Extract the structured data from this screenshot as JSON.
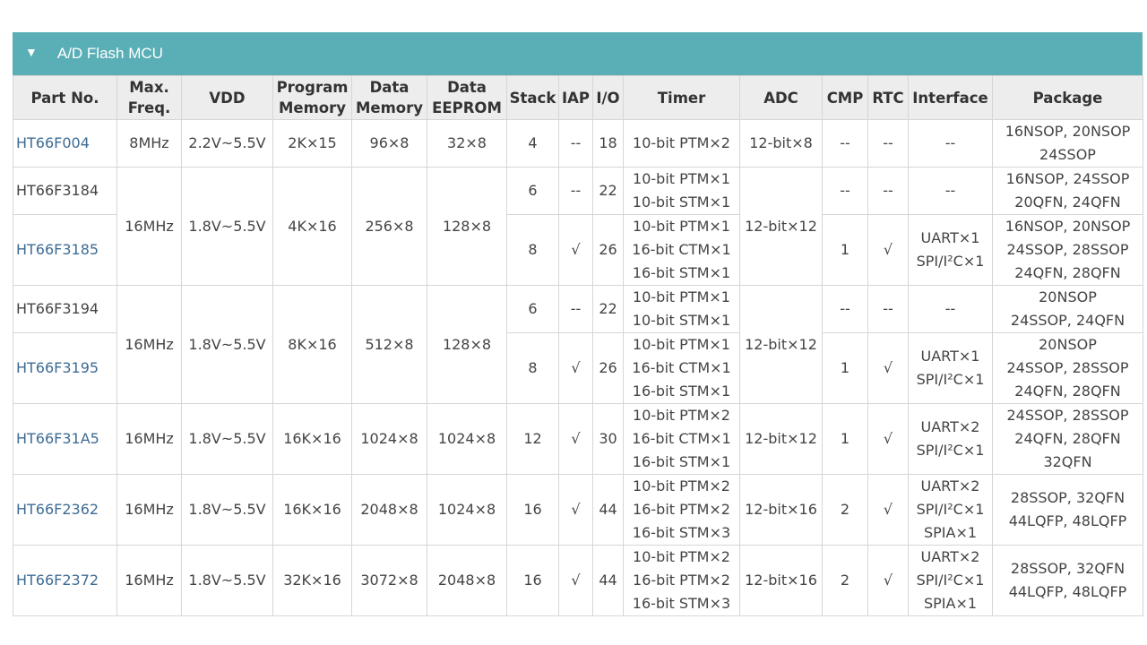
{
  "section": {
    "title": "A/D Flash MCU"
  },
  "headers": {
    "part_no": "Part No.",
    "max_freq": [
      "Max.",
      "Freq."
    ],
    "vdd": "VDD",
    "program_memory": [
      "Program",
      "Memory"
    ],
    "data_memory": [
      "Data",
      "Memory"
    ],
    "data_eeprom": [
      "Data",
      "EEPROM"
    ],
    "stack": "Stack",
    "iap": "IAP",
    "io": "I/O",
    "timer": "Timer",
    "adc": "ADC",
    "cmp": "CMP",
    "rtc": "RTC",
    "interface": "Interface",
    "package": "Package"
  },
  "groups": {
    "g1": {
      "max_freq": "8MHz",
      "vdd": "2.2V~5.5V",
      "program_memory": "2K×15",
      "data_memory": "96×8",
      "data_eeprom": "32×8",
      "adc": "12-bit×8"
    },
    "g2": {
      "max_freq": "16MHz",
      "vdd": "1.8V~5.5V",
      "program_memory": "4K×16",
      "data_memory": "256×8",
      "data_eeprom": "128×8",
      "adc": "12-bit×12"
    },
    "g3": {
      "max_freq": "16MHz",
      "vdd": "1.8V~5.5V",
      "program_memory": "8K×16",
      "data_memory": "512×8",
      "data_eeprom": "128×8",
      "adc": "12-bit×12"
    },
    "g4": {
      "max_freq": "16MHz",
      "vdd": "1.8V~5.5V",
      "program_memory": "16K×16",
      "data_memory": "1024×8",
      "data_eeprom": "1024×8",
      "adc": "12-bit×12"
    },
    "g5": {
      "max_freq": "16MHz",
      "vdd": "1.8V~5.5V",
      "program_memory": "16K×16",
      "data_memory": "2048×8",
      "data_eeprom": "1024×8",
      "adc": "12-bit×16"
    },
    "g6": {
      "max_freq": "16MHz",
      "vdd": "1.8V~5.5V",
      "program_memory": "32K×16",
      "data_memory": "3072×8",
      "data_eeprom": "2048×8",
      "adc": "12-bit×16"
    }
  },
  "rows": [
    {
      "part_no": "HT66F004",
      "stack": "4",
      "iap": "--",
      "io": "18",
      "timer": [
        "10-bit PTM×2"
      ],
      "cmp": "--",
      "rtc": "--",
      "interface": [
        "--"
      ],
      "package": [
        "16NSOP, 20NSOP",
        "24SSOP"
      ]
    },
    {
      "part_no": "HT66F3184",
      "stack": "6",
      "iap": "--",
      "io": "22",
      "timer": [
        "10-bit PTM×1",
        "10-bit STM×1"
      ],
      "cmp": "--",
      "rtc": "--",
      "interface": [
        "--"
      ],
      "package": [
        "16NSOP, 24SSOP",
        "20QFN, 24QFN"
      ]
    },
    {
      "part_no": "HT66F3185",
      "stack": "8",
      "iap": "√",
      "io": "26",
      "timer": [
        "10-bit PTM×1",
        "16-bit CTM×1",
        "16-bit STM×1"
      ],
      "cmp": "1",
      "rtc": "√",
      "interface": [
        "UART×1",
        "SPI/I²C×1"
      ],
      "package": [
        "16NSOP, 20NSOP",
        "24SSOP, 28SSOP",
        "24QFN, 28QFN"
      ]
    },
    {
      "part_no": "HT66F3194",
      "stack": "6",
      "iap": "--",
      "io": "22",
      "timer": [
        "10-bit PTM×1",
        "10-bit STM×1"
      ],
      "cmp": "--",
      "rtc": "--",
      "interface": [
        "--"
      ],
      "package": [
        "20NSOP",
        "24SSOP, 24QFN"
      ]
    },
    {
      "part_no": "HT66F3195",
      "stack": "8",
      "iap": "√",
      "io": "26",
      "timer": [
        "10-bit PTM×1",
        "16-bit CTM×1",
        "16-bit STM×1"
      ],
      "cmp": "1",
      "rtc": "√",
      "interface": [
        "UART×1",
        "SPI/I²C×1"
      ],
      "package": [
        "20NSOP",
        "24SSOP, 28SSOP",
        "24QFN, 28QFN"
      ]
    },
    {
      "part_no": "HT66F31A5",
      "stack": "12",
      "iap": "√",
      "io": "30",
      "timer": [
        "10-bit PTM×2",
        "16-bit CTM×1",
        "16-bit STM×1"
      ],
      "cmp": "1",
      "rtc": "√",
      "interface": [
        "UART×2",
        "SPI/I²C×1"
      ],
      "package": [
        "24SSOP, 28SSOP",
        "24QFN, 28QFN",
        "32QFN"
      ]
    },
    {
      "part_no": "HT66F2362",
      "stack": "16",
      "iap": "√",
      "io": "44",
      "timer": [
        "10-bit PTM×2",
        "16-bit PTM×2",
        "16-bit STM×3"
      ],
      "cmp": "2",
      "rtc": "√",
      "interface": [
        "UART×2",
        "SPI/I²C×1",
        "SPIA×1"
      ],
      "package": [
        "28SSOP, 32QFN",
        "44LQFP, 48LQFP"
      ]
    },
    {
      "part_no": "HT66F2372",
      "stack": "16",
      "iap": "√",
      "io": "44",
      "timer": [
        "10-bit PTM×2",
        "16-bit PTM×2",
        "16-bit STM×3"
      ],
      "cmp": "2",
      "rtc": "√",
      "interface": [
        "UART×2",
        "SPI/I²C×1",
        "SPIA×1"
      ],
      "package": [
        "28SSOP, 32QFN",
        "44LQFP, 48LQFP"
      ]
    }
  ]
}
